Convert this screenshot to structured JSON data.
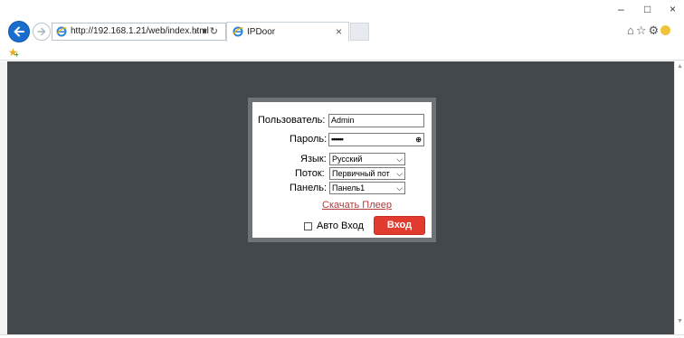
{
  "browser": {
    "url": "http://192.168.1.21/web/index.html",
    "address_tools": "⌕ ▾ ↻",
    "tab_title": "IPDoor",
    "tab_close": "×",
    "window_controls": {
      "minimize": "–",
      "maximize": "□",
      "close": "×"
    },
    "toolbar_icons": [
      "home-icon",
      "favorites-star-icon",
      "settings-gear-icon",
      "feedback-smiley-icon"
    ],
    "accent_color": "#1a6dcc"
  },
  "page": {
    "background_color": "#43484d"
  },
  "login": {
    "username_label": "Пользователь:",
    "username_value": "Admin",
    "password_label": "Пароль:",
    "password_value": "••••••",
    "language_label": "Язык:",
    "language_value": "Русский",
    "stream_label": "Поток:",
    "stream_value": "Первичный пот",
    "panel_label": "Панель:",
    "panel_value": "Панель1",
    "download_link": "Скачать Плеер",
    "auto_login_label": "Авто Вход",
    "auto_login_checked": false,
    "login_button": "Вход",
    "button_color": "#e23b2f"
  }
}
